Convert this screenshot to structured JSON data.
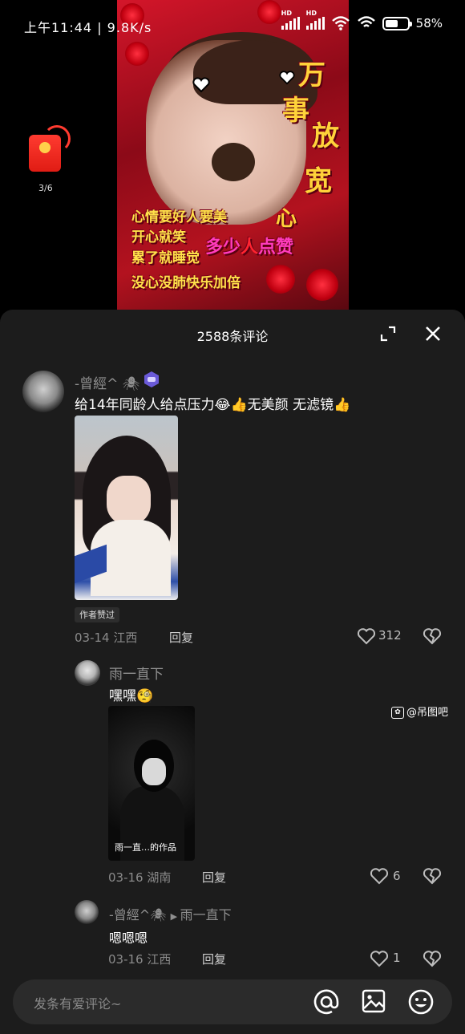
{
  "status_bar": {
    "time_speed": "上午11:44 | 9.8K/s",
    "network_label": "HD",
    "battery": "58%",
    "battery_level": 0.58
  },
  "video": {
    "overlay_title_chars": [
      "万",
      "事",
      "放",
      "宽",
      "心"
    ],
    "overlay_lines": [
      "心情要好人要美",
      "开心就笑",
      "累了就睡觉",
      "没心没肺快乐加倍"
    ],
    "overlay_mixed": [
      "多少",
      "人",
      "点赞"
    ]
  },
  "red_packet": {
    "count": "3/6"
  },
  "panel": {
    "title": "2588条评论"
  },
  "comments": [
    {
      "username": "-曾經^",
      "text": "给14年同龄人给点压力😂👍无美颜 无滤镜👍",
      "badge": "作者赞过",
      "date_loc": "03-14 江西",
      "reply": "回复",
      "likes": "312"
    },
    {
      "username": "雨一直下",
      "text": "嘿嘿🧐",
      "photo_caption": "雨一直…的作品",
      "date_loc": "03-16 湖南",
      "reply": "回复",
      "likes": "6"
    },
    {
      "username": "-曾經^",
      "reply_to": "雨一直下",
      "text": "嗯嗯嗯",
      "date_loc": "03-16 江西",
      "reply": "回复",
      "likes": "1"
    }
  ],
  "input": {
    "placeholder": "发条有爱评论~"
  },
  "watermark": "@吊图吧",
  "colors": {
    "panel_bg": "#1c1c1c",
    "input_bg": "#2b2b2b",
    "secondary_text": "#8a8a8a"
  }
}
